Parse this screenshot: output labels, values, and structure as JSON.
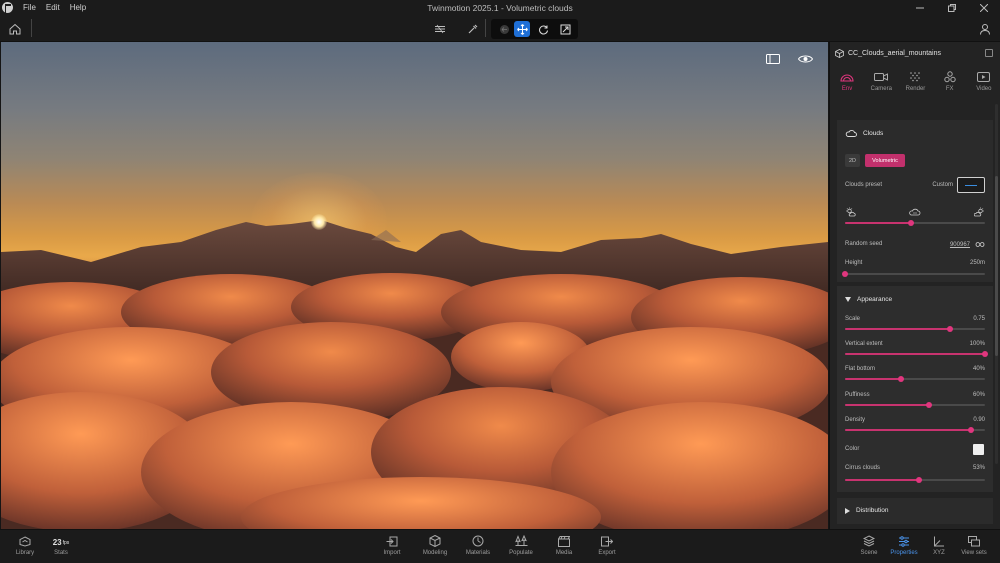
{
  "titlebar": {
    "menu": [
      "File",
      "Edit",
      "Help"
    ],
    "title": "Twinmotion 2025.1 - Volumetric clouds"
  },
  "panel": {
    "scene_name": "CC_Clouds_aerial_mountains",
    "tabs": [
      {
        "label": "Env",
        "icon": "env-icon",
        "active": true
      },
      {
        "label": "Camera",
        "icon": "camera-icon",
        "active": false
      },
      {
        "label": "Render",
        "icon": "render-icon",
        "active": false
      },
      {
        "label": "FX",
        "icon": "fx-icon",
        "active": false
      },
      {
        "label": "Video",
        "icon": "video-icon",
        "active": false
      }
    ],
    "clouds": {
      "title": "Clouds",
      "mode_2d": "2D",
      "mode_volumetric": "Volumetric",
      "preset_label": "Clouds preset",
      "preset_value": "Custom",
      "coverage": 0.47,
      "random_seed_label": "Random seed",
      "random_seed_value": "900967",
      "height_label": "Height",
      "height_value": "250m",
      "height_level": 0.0
    },
    "appearance": {
      "title": "Appearance",
      "sliders": [
        {
          "label": "Scale",
          "value": "0.75",
          "level": 0.75
        },
        {
          "label": "Vertical extent",
          "value": "100%",
          "level": 1.0
        },
        {
          "label": "Flat bottom",
          "value": "40%",
          "level": 0.4
        },
        {
          "label": "Puffiness",
          "value": "60%",
          "level": 0.6
        },
        {
          "label": "Density",
          "value": "0.90",
          "level": 0.9
        }
      ],
      "color_label": "Color",
      "color_value": "#efefef",
      "cirrus_label": "Cirrus clouds",
      "cirrus_value": "53%",
      "cirrus_level": 0.53
    },
    "distribution": {
      "title": "Distribution"
    }
  },
  "bottombar": {
    "left": [
      {
        "label": "Library",
        "icon": "library-icon"
      },
      {
        "label": "Stats",
        "value": "23",
        "unit": "fps"
      }
    ],
    "center": [
      {
        "label": "Import",
        "icon": "import-icon"
      },
      {
        "label": "Modeling",
        "icon": "modeling-icon"
      },
      {
        "label": "Materials",
        "icon": "materials-icon"
      },
      {
        "label": "Populate",
        "icon": "populate-icon"
      },
      {
        "label": "Media",
        "icon": "media-icon"
      },
      {
        "label": "Export",
        "icon": "export-icon"
      }
    ],
    "right": [
      {
        "label": "Scene",
        "icon": "scene-icon",
        "active": false
      },
      {
        "label": "Properties",
        "icon": "properties-icon",
        "active": true
      },
      {
        "label": "XYZ",
        "icon": "xyz-icon",
        "active": false
      },
      {
        "label": "View sets",
        "icon": "view-sets-icon",
        "active": false
      }
    ]
  },
  "colors": {
    "accent_pink": "#c2306c",
    "accent_blue": "#1f6fd6",
    "panel_bg": "#232323"
  }
}
